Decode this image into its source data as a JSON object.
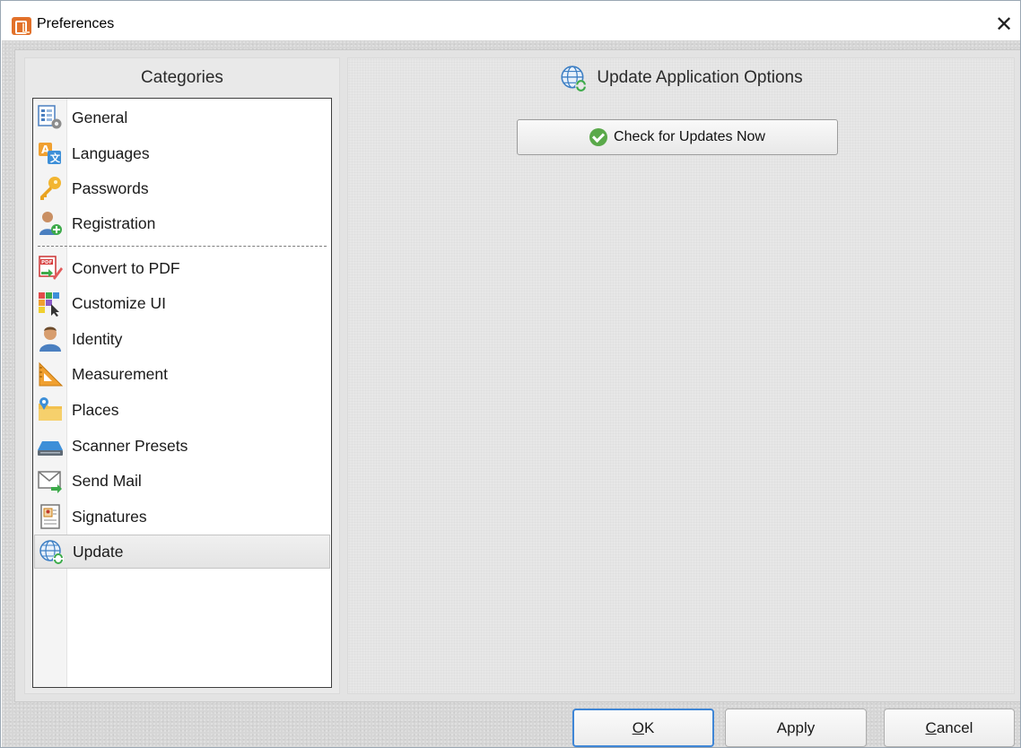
{
  "window": {
    "title": "Preferences",
    "close_glyph": "✕"
  },
  "left": {
    "header": "Categories",
    "items": [
      {
        "label": "General",
        "icon": "general-settings-icon"
      },
      {
        "label": "Languages",
        "icon": "languages-icon"
      },
      {
        "label": "Passwords",
        "icon": "key-icon"
      },
      {
        "label": "Registration",
        "icon": "registration-user-icon"
      },
      {
        "label": "Convert to PDF",
        "icon": "convert-to-pdf-icon"
      },
      {
        "label": "Customize UI",
        "icon": "customize-ui-icon"
      },
      {
        "label": "Identity",
        "icon": "identity-user-icon"
      },
      {
        "label": "Measurement",
        "icon": "ruler-triangle-icon"
      },
      {
        "label": "Places",
        "icon": "folder-places-icon"
      },
      {
        "label": "Scanner Presets",
        "icon": "scanner-icon"
      },
      {
        "label": "Send Mail",
        "icon": "envelope-icon"
      },
      {
        "label": "Signatures",
        "icon": "signature-document-icon"
      },
      {
        "label": "Update",
        "icon": "globe-update-icon",
        "selected": true
      }
    ]
  },
  "right": {
    "header": "Update Application Options",
    "header_icon": "globe-update-icon",
    "check_button": "Check for Updates Now",
    "check_icon": "green-check-icon"
  },
  "footer": {
    "ok": {
      "mnemonic": "O",
      "rest": "K"
    },
    "apply": {
      "label": "Apply"
    },
    "cancel": {
      "mnemonic": "C",
      "rest": "ancel"
    }
  },
  "colors": {
    "selection_border": "#c4c4c4",
    "default_button_border": "#3f86d6",
    "accent_orange": "#e2712a",
    "check_green": "#5aa94a"
  }
}
